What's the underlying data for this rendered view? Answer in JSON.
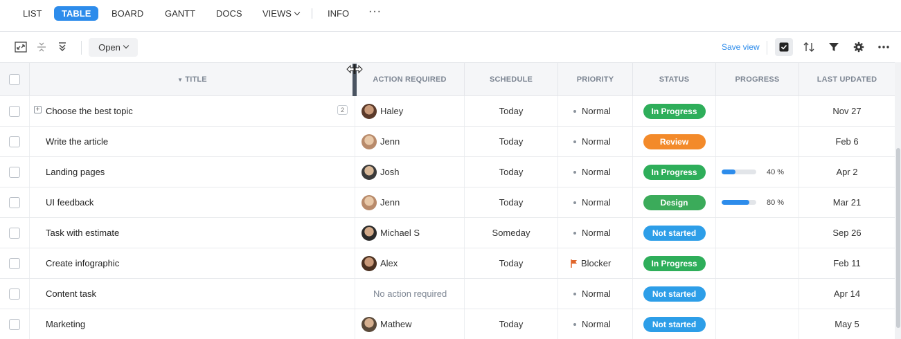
{
  "nav": {
    "tabs": [
      {
        "label": "LIST",
        "active": false
      },
      {
        "label": "TABLE",
        "active": true
      },
      {
        "label": "BOARD",
        "active": false
      },
      {
        "label": "GANTT",
        "active": false
      },
      {
        "label": "DOCS",
        "active": false
      },
      {
        "label": "VIEWS",
        "active": false
      },
      {
        "label": "INFO",
        "active": false
      }
    ],
    "more_label": "···"
  },
  "toolbar": {
    "filter_select": "Open",
    "save_view_label": "Save view",
    "icons": [
      "expand-icon",
      "collapse-icon",
      "collapse-all-icon",
      "checkbox-toggle-icon",
      "sort-icon",
      "filter-icon",
      "settings-icon",
      "more-icon"
    ]
  },
  "columns": [
    "TITLE",
    "ACTION REQUIRED",
    "SCHEDULE",
    "PRIORITY",
    "STATUS",
    "PROGRESS",
    "LAST UPDATED"
  ],
  "colors": {
    "accent": "#2d8ceb",
    "in_progress": "#2eae5a",
    "review": "#f38a2a",
    "design": "#3bab5a",
    "not_started": "#2d9ee8",
    "blocker_flag": "#e0652a"
  },
  "rows": [
    {
      "title": "Choose the best topic",
      "subtasks": "2",
      "assignee": "Haley",
      "schedule": "Today",
      "priority": "Normal",
      "status": "In Progress",
      "status_color": "#2eae5a",
      "progress": null,
      "progress_label": "",
      "updated": "Nov 27"
    },
    {
      "title": "Write the article",
      "subtasks": "",
      "assignee": "Jenn",
      "schedule": "Today",
      "priority": "Normal",
      "status": "Review",
      "status_color": "#f38a2a",
      "progress": null,
      "progress_label": "",
      "updated": "Feb 6"
    },
    {
      "title": "Landing pages",
      "subtasks": "",
      "assignee": "Josh",
      "schedule": "Today",
      "priority": "Normal",
      "status": "In Progress",
      "status_color": "#2eae5a",
      "progress": 40,
      "progress_label": "40 %",
      "updated": "Apr 2"
    },
    {
      "title": "UI feedback",
      "subtasks": "",
      "assignee": "Jenn",
      "schedule": "Today",
      "priority": "Normal",
      "status": "Design",
      "status_color": "#3bab5a",
      "progress": 80,
      "progress_label": "80 %",
      "updated": "Mar 21"
    },
    {
      "title": "Task with estimate",
      "subtasks": "",
      "assignee": "Michael S",
      "schedule": "Someday",
      "priority": "Normal",
      "status": "Not started",
      "status_color": "#2d9ee8",
      "progress": null,
      "progress_label": "",
      "updated": "Sep 26"
    },
    {
      "title": "Create infographic",
      "subtasks": "",
      "assignee": "Alex",
      "schedule": "Today",
      "priority": "Blocker",
      "status": "In Progress",
      "status_color": "#2eae5a",
      "progress": null,
      "progress_label": "",
      "updated": "Feb 11"
    },
    {
      "title": "Content task",
      "subtasks": "",
      "assignee": "",
      "no_action": "No action required",
      "schedule": "",
      "priority": "Normal",
      "status": "Not started",
      "status_color": "#2d9ee8",
      "progress": null,
      "progress_label": "",
      "updated": "Apr 14"
    },
    {
      "title": "Marketing",
      "subtasks": "",
      "assignee": "Mathew",
      "schedule": "Today",
      "priority": "Normal",
      "status": "Not started",
      "status_color": "#2d9ee8",
      "progress": null,
      "progress_label": "",
      "updated": "May 5"
    }
  ]
}
